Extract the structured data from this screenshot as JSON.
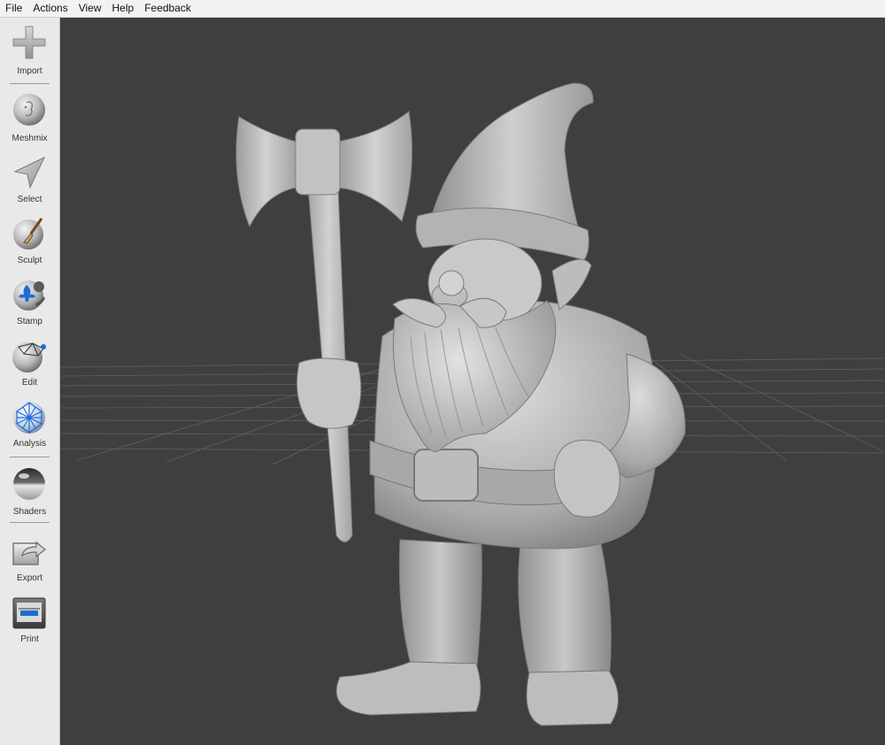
{
  "menu": {
    "items": [
      "File",
      "Actions",
      "View",
      "Help",
      "Feedback"
    ]
  },
  "toolbar": {
    "import": "Import",
    "meshmix": "Meshmix",
    "select": "Select",
    "sculpt": "Sculpt",
    "stamp": "Stamp",
    "edit": "Edit",
    "analysis": "Analysis",
    "shaders": "Shaders",
    "export": "Export",
    "print": "Print"
  },
  "icons": {
    "import": "plus-icon",
    "meshmix": "face-sphere-icon",
    "select": "arrow-cursor-icon",
    "sculpt": "brush-sphere-icon",
    "stamp": "stamp-sphere-icon",
    "edit": "mesh-edit-icon",
    "analysis": "wireframe-sphere-icon",
    "shaders": "chrome-sphere-icon",
    "export": "export-box-icon",
    "print": "printer-icon"
  },
  "colors": {
    "viewport_bg": "#3f3f3f",
    "toolbar_bg": "#e9e9e9",
    "model": "#b5b5b5",
    "accent_blue": "#2a6fc9"
  }
}
